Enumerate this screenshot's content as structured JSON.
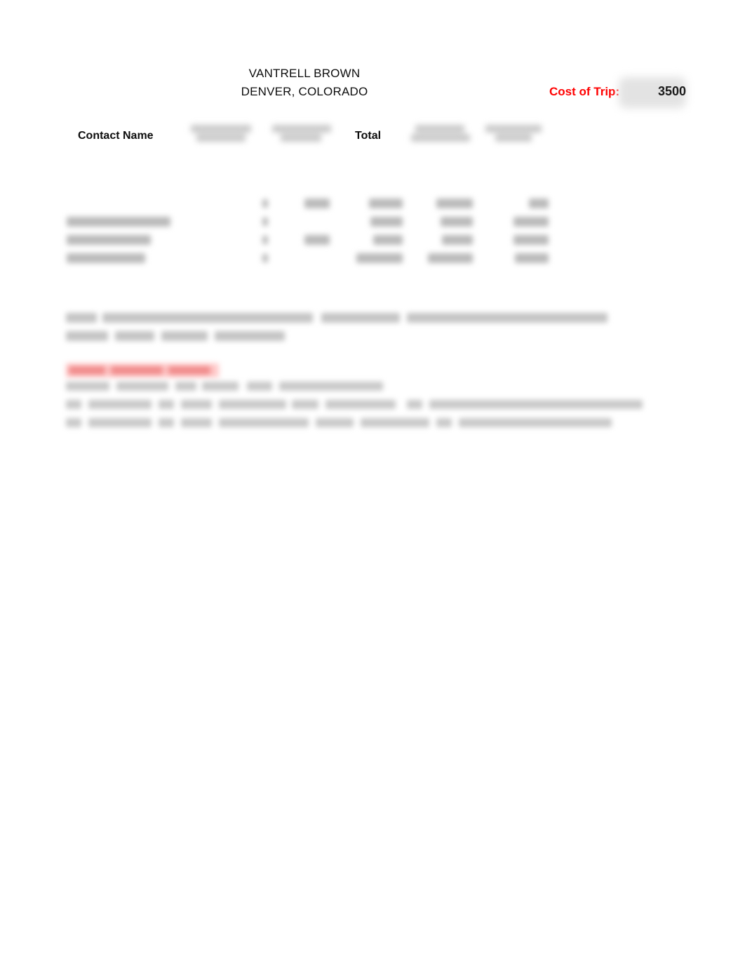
{
  "document": {
    "title_line_1": "VANTRELL BROWN",
    "title_line_2": "DENVER, COLORADO"
  },
  "cost_of_trip": {
    "label": "Cost of Trip:",
    "value": "3500"
  },
  "table": {
    "headers": {
      "contact_name": "Contact Name",
      "redacted_1": "",
      "redacted_2": "",
      "total": "Total",
      "redacted_3": "",
      "redacted_4": ""
    },
    "rows": [
      {
        "name": "",
        "c1": "",
        "c2": "",
        "c3": "",
        "c4": "",
        "c5": ""
      },
      {
        "name": "",
        "c1": "",
        "c2": "",
        "c3": "",
        "c4": "",
        "c5": ""
      },
      {
        "name": "",
        "c1": "",
        "c2": "",
        "c3": "",
        "c4": "",
        "c5": ""
      },
      {
        "name": "",
        "c1": "",
        "c2": "",
        "c3": "",
        "c4": "",
        "c5": ""
      }
    ]
  },
  "note": {
    "line_1": "",
    "line_2": ""
  },
  "red_note": {
    "heading": "",
    "line_1": "",
    "line_2": "",
    "line_3": ""
  },
  "colors": {
    "accent_red": "#ff0000",
    "highlight_pink": "#ffc9c9",
    "redaction_gray": "#e3e3e3",
    "text": "#0d0d0d"
  }
}
